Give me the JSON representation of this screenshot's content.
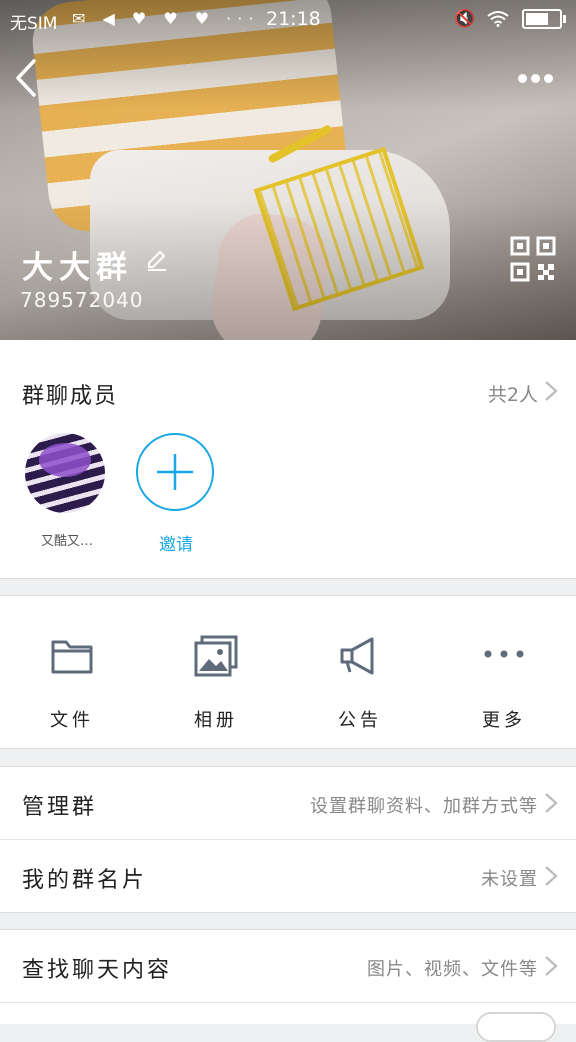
{
  "status_bar": {
    "carrier": "无SIM",
    "icons": "✉ ◀ ♥ ♥ ♥ ···",
    "time": "21:18"
  },
  "header": {
    "group_name": "大大群",
    "group_id": "789572040"
  },
  "members": {
    "title": "群聊成员",
    "count": "共2人",
    "member_name": "又酷又…",
    "invite_label": "邀请"
  },
  "tools": [
    {
      "label": "文件",
      "icon": "folder-icon"
    },
    {
      "label": "相册",
      "icon": "album-icon"
    },
    {
      "label": "公告",
      "icon": "megaphone-icon"
    },
    {
      "label": "更多",
      "icon": "more-dots-icon"
    }
  ],
  "settings": {
    "manage": {
      "label": "管理群",
      "value": "设置群聊资料、加群方式等"
    },
    "card": {
      "label": "我的群名片",
      "value": "未设置"
    },
    "search": {
      "label": "查找聊天内容",
      "value": "图片、视频、文件等"
    }
  },
  "colors": {
    "accent": "#1aa7e6",
    "icon_gray": "#5f6b7a"
  }
}
